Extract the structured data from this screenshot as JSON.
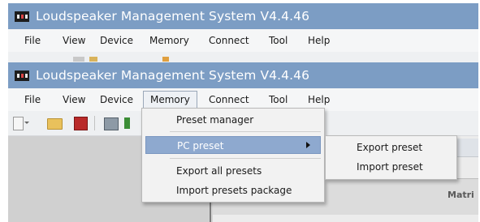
{
  "window_back": {
    "title": "Loudspeaker Management System V4.4.46",
    "menu": [
      "File",
      "View",
      "Device",
      "Memory",
      "Connect",
      "Tool",
      "Help"
    ]
  },
  "window_front": {
    "title": "Loudspeaker Management System V4.4.46",
    "menu": [
      "File",
      "View",
      "Device",
      "Memory",
      "Connect",
      "Tool",
      "Help"
    ],
    "active_menu": "Memory"
  },
  "memory_menu": {
    "items": [
      {
        "label": "Preset manager"
      },
      {
        "label": "PC preset",
        "has_submenu": true,
        "highlighted": true
      },
      {
        "label": "Export all presets"
      },
      {
        "label": "Import presets package"
      }
    ]
  },
  "pc_preset_submenu": {
    "items": [
      {
        "label": "Export preset"
      },
      {
        "label": "Import preset"
      }
    ]
  },
  "content": {
    "partial_label": "Matri"
  },
  "colors": {
    "titlebar": "#7c9dc4",
    "menu_highlight": "#8ea9cf"
  },
  "icons": [
    "app-logo-icon",
    "new-file-icon",
    "open-folder-icon",
    "save-icon",
    "print-icon",
    "device-icon"
  ]
}
